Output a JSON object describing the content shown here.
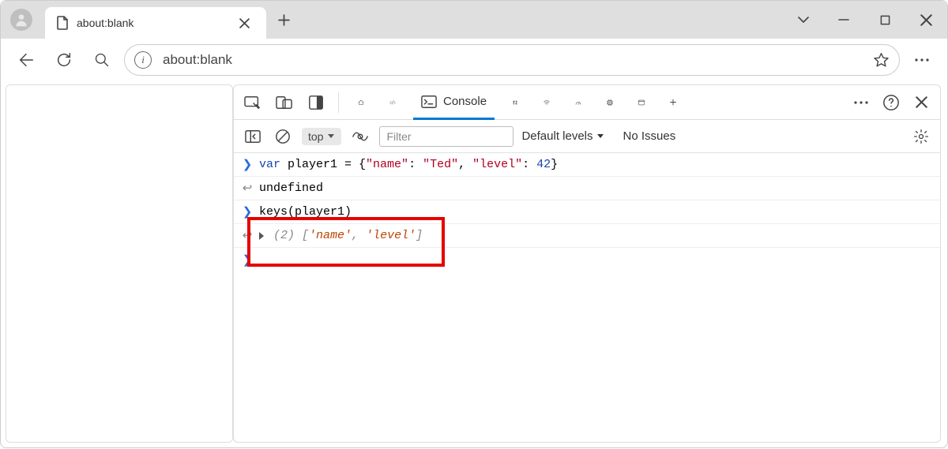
{
  "tab": {
    "title": "about:blank"
  },
  "omnibox": {
    "url": "about:blank"
  },
  "devtools": {
    "tabs": {
      "console": "Console"
    },
    "toolbar": {
      "context": "top",
      "filter_placeholder": "Filter",
      "levels": "Default levels",
      "issues": "No Issues"
    }
  },
  "console": {
    "line1": {
      "kw": "var",
      "ident": " player1 = {",
      "key1": "\"name\"",
      "colon1": ": ",
      "val1": "\"Ted\"",
      "comma": ", ",
      "key2": "\"level\"",
      "colon2": ": ",
      "val2": "42",
      "close": "}"
    },
    "line2": "undefined",
    "line3": "keys(player1)",
    "line4": {
      "count": "(2) ",
      "open": "[",
      "v1": "'name'",
      "sep": ", ",
      "v2": "'level'",
      "close": "]"
    }
  }
}
